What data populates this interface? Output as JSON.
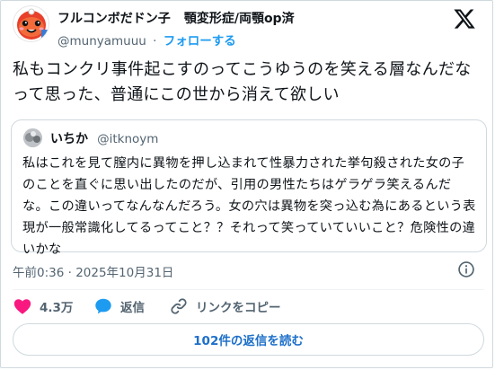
{
  "author": {
    "display_name": "フルコンボだドン子",
    "name_suffix": "顎変形症/両顎op済",
    "handle": "@munyamuuu",
    "separator": "·",
    "follow_label": "フォローする"
  },
  "tweet": {
    "text": "私もコンクリ事件起こすのってこうゆうのを笑える層なんだなって思った、普通にこの世から消えて欲しい"
  },
  "quoted": {
    "display_name": "いちか",
    "handle": "@itknoym",
    "text": "私はこれを見て膣内に異物を押し込まれて性暴力された挙句殺された女の子のことを直ぐに思い出したのだが、引用の男性たちはゲラゲラ笑えるんだな。この違いってなんなんだろう。女の穴は異物を突っ込む為にあるという表現が一般常識化してるってこと？？それって笑っていていいこと？危険性の違いかな"
  },
  "meta": {
    "timestamp": "午前0:36 · 2025年10月31日"
  },
  "actions": {
    "like_count": "4.3万",
    "reply_label": "返信",
    "copy_link_label": "リンクをコピー"
  },
  "read_replies_label": "102件の返信を読む",
  "colors": {
    "accent": "#1d9bf0",
    "like_red": "#f91880",
    "text_primary": "#0f1419",
    "text_secondary": "#536471",
    "border": "#cfd9de"
  },
  "icons": {
    "brand": "x-logo-icon",
    "like": "heart-icon",
    "reply": "speech-bubble-icon",
    "copy": "link-icon",
    "info": "info-icon"
  }
}
